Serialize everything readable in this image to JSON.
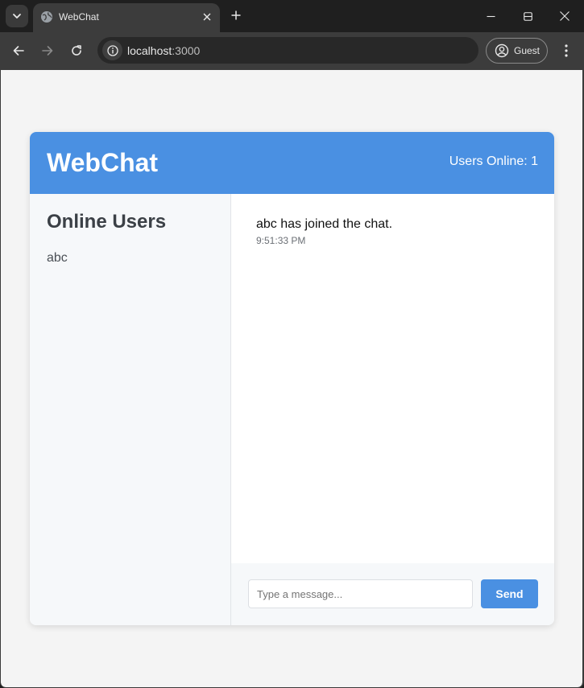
{
  "browser": {
    "tab_title": "WebChat",
    "url_host": "localhost",
    "url_port": ":3000",
    "profile_label": "Guest"
  },
  "app": {
    "title": "WebChat",
    "online_label": "Users Online: 1"
  },
  "sidebar": {
    "title": "Online Users",
    "users": [
      "abc"
    ]
  },
  "messages": [
    {
      "text": "abc has joined the chat.",
      "time": "9:51:33 PM"
    }
  ],
  "composer": {
    "placeholder": "Type a message...",
    "value": "",
    "send_label": "Send"
  },
  "colors": {
    "accent": "#4a90e2",
    "sidebar_bg": "#f6f8fa",
    "page_bg": "#f4f4f4"
  }
}
